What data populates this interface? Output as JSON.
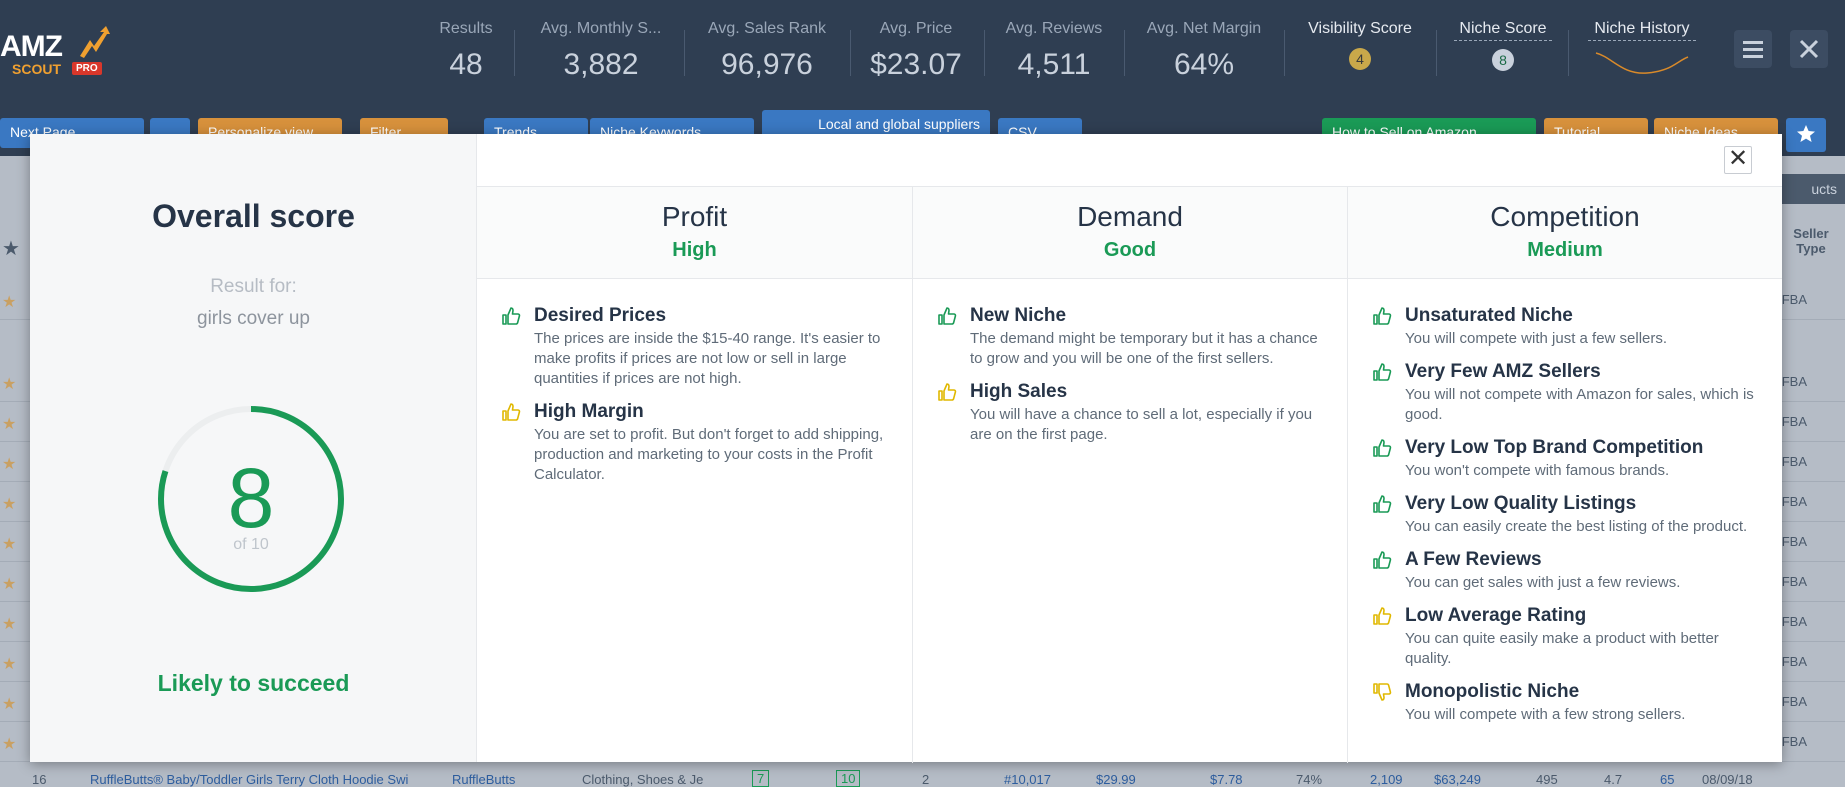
{
  "topbar": {
    "logo": {
      "amz": "AMZ",
      "scout": "SCOUT",
      "pro": "PRO"
    },
    "stats": [
      {
        "label": "Results",
        "value": "48"
      },
      {
        "label": "Avg. Monthly S...",
        "value": "3,882"
      },
      {
        "label": "Avg. Sales Rank",
        "value": "96,976"
      },
      {
        "label": "Avg. Price",
        "value": "$23.07"
      },
      {
        "label": "Avg. Reviews",
        "value": "4,511"
      },
      {
        "label": "Avg. Net Margin",
        "value": "64%"
      }
    ],
    "visibility": {
      "label": "Visibility Score",
      "value": "4",
      "color": "#c9a84a"
    },
    "niche_score": {
      "label": "Niche Score",
      "value": "8",
      "color": "#1a9a56"
    },
    "niche_history": {
      "label": "Niche History"
    }
  },
  "toolbar": {
    "next_page": "Next Page",
    "personalize": "Personalize view",
    "filter": "Filter",
    "trends": "Trends",
    "niche_keywords": "Niche Keywords",
    "suppliers": "Local and global suppliers",
    "csv": "CSV",
    "how_to_sell": "How to Sell on Amazon",
    "tutorial": "Tutorial",
    "niche_ideas": "Niche Ideas",
    "products": "ucts"
  },
  "background": {
    "seller_type_header": "Seller Type",
    "fba": "FBA",
    "bottom_row": {
      "num": "16",
      "product": "RuffleButts® Baby/Toddler Girls Terry Cloth Hoodie Swi",
      "brand": "RuffleButts",
      "category": "Clothing, Shoes & Je",
      "s1": "7",
      "s2": "10",
      "sellers": "2",
      "rank": "#10,017",
      "price": "$29.99",
      "fee": "$7.78",
      "margin": "74%",
      "sales": "2,109",
      "revenue": "$63,249",
      "reviews": "495",
      "rating": "4.7",
      "lqs": "65",
      "date": "08/09/18"
    }
  },
  "modal": {
    "title": "Overall score",
    "result_for_label": "Result for:",
    "query": "girls cover up",
    "score": "8",
    "score_of": "of 10",
    "score_fraction": 0.8,
    "verdict": "Likely to succeed",
    "close": "✕",
    "columns": [
      {
        "title": "Profit",
        "level": "High",
        "items": [
          {
            "icon": "thumbs-up",
            "color": "#1a9a56",
            "title": "Desired Prices",
            "desc": "The prices are inside the $15-40 range. It's easier to make profits if prices are not low or sell in large quantities if prices are not high."
          },
          {
            "icon": "thumbs-up",
            "color": "#e0b800",
            "title": "High Margin",
            "desc": "You are set to profit. But don't forget to add shipping, production and marketing to your costs in the Profit Calculator."
          }
        ]
      },
      {
        "title": "Demand",
        "level": "Good",
        "items": [
          {
            "icon": "thumbs-up",
            "color": "#1a9a56",
            "title": "New Niche",
            "desc": "The demand might be temporary but it has a chance to grow and you will be one of the first sellers."
          },
          {
            "icon": "thumbs-up",
            "color": "#e0b800",
            "title": "High Sales",
            "desc": "You will have a chance to sell a lot, especially if you are on the first page."
          }
        ]
      },
      {
        "title": "Competition",
        "level": "Medium",
        "items": [
          {
            "icon": "thumbs-up",
            "color": "#1a9a56",
            "title": "Unsaturated Niche",
            "desc": "You will compete with just a few sellers."
          },
          {
            "icon": "thumbs-up",
            "color": "#1a9a56",
            "title": "Very Few AMZ Sellers",
            "desc": "You will not compete with Amazon for sales, which is good."
          },
          {
            "icon": "thumbs-up",
            "color": "#1a9a56",
            "title": "Very Low Top Brand Competition",
            "desc": "You won't compete with famous brands."
          },
          {
            "icon": "thumbs-up",
            "color": "#1a9a56",
            "title": "Very Low Quality Listings",
            "desc": "You can easily create the best listing of the product."
          },
          {
            "icon": "thumbs-up",
            "color": "#1a9a56",
            "title": "A Few Reviews",
            "desc": "You can get sales with just a few reviews."
          },
          {
            "icon": "thumbs-up",
            "color": "#e0b800",
            "title": "Low Average Rating",
            "desc": "You can quite easily make a product with better quality."
          },
          {
            "icon": "thumbs-down",
            "color": "#e0b800",
            "title": "Monopolistic Niche",
            "desc": "You will compete with a few strong sellers."
          }
        ]
      }
    ]
  }
}
